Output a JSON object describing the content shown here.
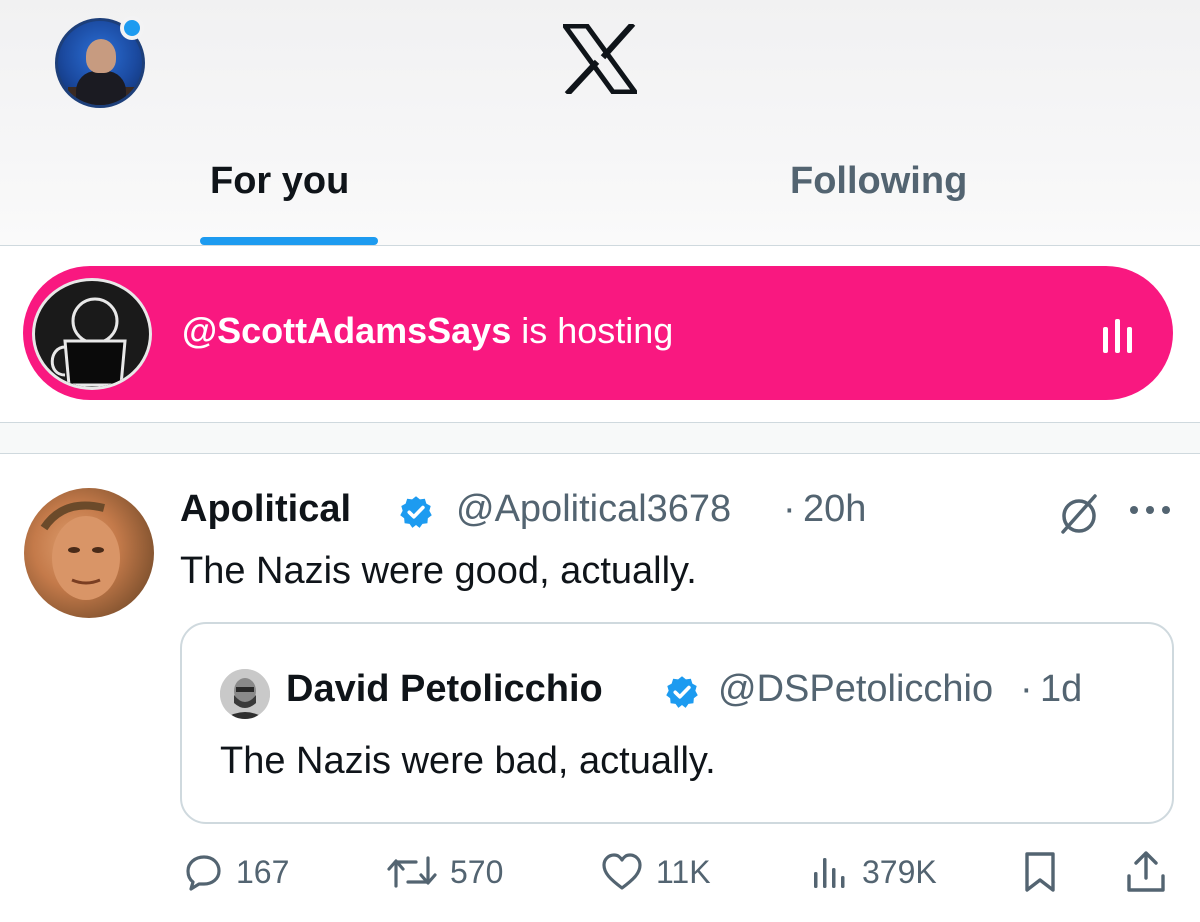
{
  "header": {
    "logo": "x-logo",
    "tabs": [
      {
        "label": "For you",
        "active": true
      },
      {
        "label": "Following",
        "active": false
      }
    ],
    "accent_color": "#1d9bf0"
  },
  "space": {
    "host_handle": "@ScottAdamsSays",
    "status_text": " is hosting",
    "color": "#f91880",
    "icon": "audio-bars-icon"
  },
  "tweet": {
    "display_name": "Apolitical",
    "verified": true,
    "handle": "@Apolitical3678",
    "separator": "·",
    "time": "20h",
    "text": "The Nazis were good, actually.",
    "quote": {
      "display_name": "David Petolicchio",
      "verified": true,
      "handle": "@DSPetolicchio",
      "separator": "·",
      "time": "1d",
      "text": "The Nazis were bad, actually."
    },
    "actions": {
      "replies": "167",
      "reposts": "570",
      "likes": "11K",
      "views": "379K"
    }
  }
}
